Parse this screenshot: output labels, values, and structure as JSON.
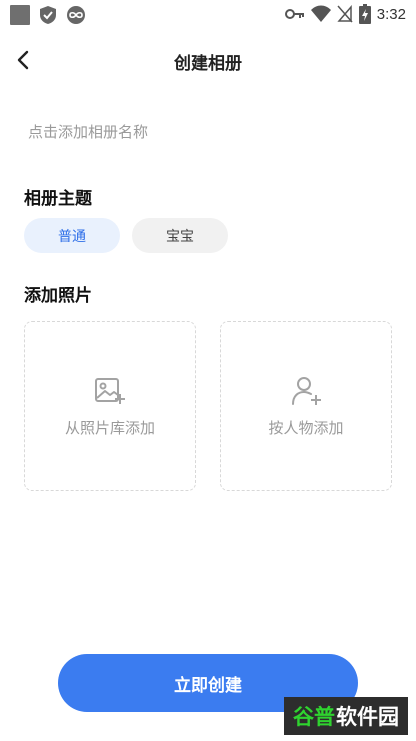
{
  "status_bar": {
    "time": "3:32",
    "left_icons": [
      "gallery-icon",
      "shield-check-icon",
      "infinity-icon"
    ],
    "right_icons": [
      "key-icon",
      "wifi-icon",
      "signal-off-icon",
      "battery-charging-icon"
    ]
  },
  "header": {
    "back_icon": "chevron-left-icon",
    "title": "创建相册"
  },
  "album_name": {
    "placeholder": "点击添加相册名称",
    "value": ""
  },
  "theme": {
    "title": "相册主题",
    "options": [
      {
        "label": "普通",
        "selected": true
      },
      {
        "label": "宝宝",
        "selected": false
      }
    ]
  },
  "photos": {
    "title": "添加照片",
    "cards": [
      {
        "icon": "image-add-icon",
        "label": "从照片库添加"
      },
      {
        "icon": "person-add-icon",
        "label": "按人物添加"
      }
    ]
  },
  "create_button": {
    "label": "立即创建"
  },
  "watermark": {
    "part1": "谷普",
    "part2": "软件园"
  },
  "colors": {
    "accent": "#3b7cf0",
    "chip_active_bg": "#e9f1fd",
    "chip_active_text": "#2f6fe8",
    "chip_inactive_bg": "#f1f1f1",
    "placeholder": "#9a9a9a"
  }
}
